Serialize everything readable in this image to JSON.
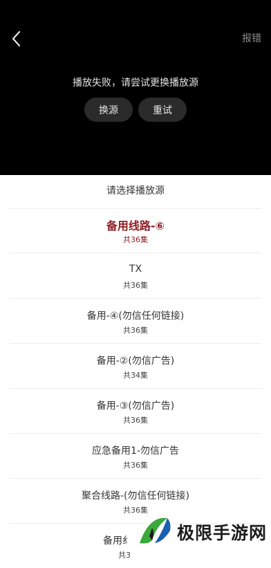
{
  "player": {
    "report_label": "报错",
    "error_message": "播放失败，请尝试更换播放源",
    "switch_label": "换源",
    "retry_label": "重试"
  },
  "sheet": {
    "title": "请选择播放源",
    "sources": [
      {
        "name": "备用线路-⑥",
        "count": "共36集",
        "selected": true
      },
      {
        "name": "TX",
        "count": "共36集",
        "selected": false
      },
      {
        "name": "备用-④(勿信任何链接)",
        "count": "共36集",
        "selected": false
      },
      {
        "name": "备用-②(勿信广告)",
        "count": "共34集",
        "selected": false
      },
      {
        "name": "备用-③(勿信广告)",
        "count": "共36集",
        "selected": false
      },
      {
        "name": "应急备用1-勿信广告",
        "count": "共36集",
        "selected": false
      },
      {
        "name": "聚合线路-(勿信任何链接)",
        "count": "共36集",
        "selected": false
      },
      {
        "name": "备用纟",
        "count": "共3",
        "selected": false
      }
    ]
  },
  "watermark": {
    "text": "极限手游网",
    "colors": {
      "green": "#3aa83a",
      "blue": "#1b5fb0",
      "dark": "#1c1c1c"
    }
  },
  "colors": {
    "accent": "#8f1e24",
    "player_bg": "#000000",
    "button_bg": "#2b2b2b"
  }
}
